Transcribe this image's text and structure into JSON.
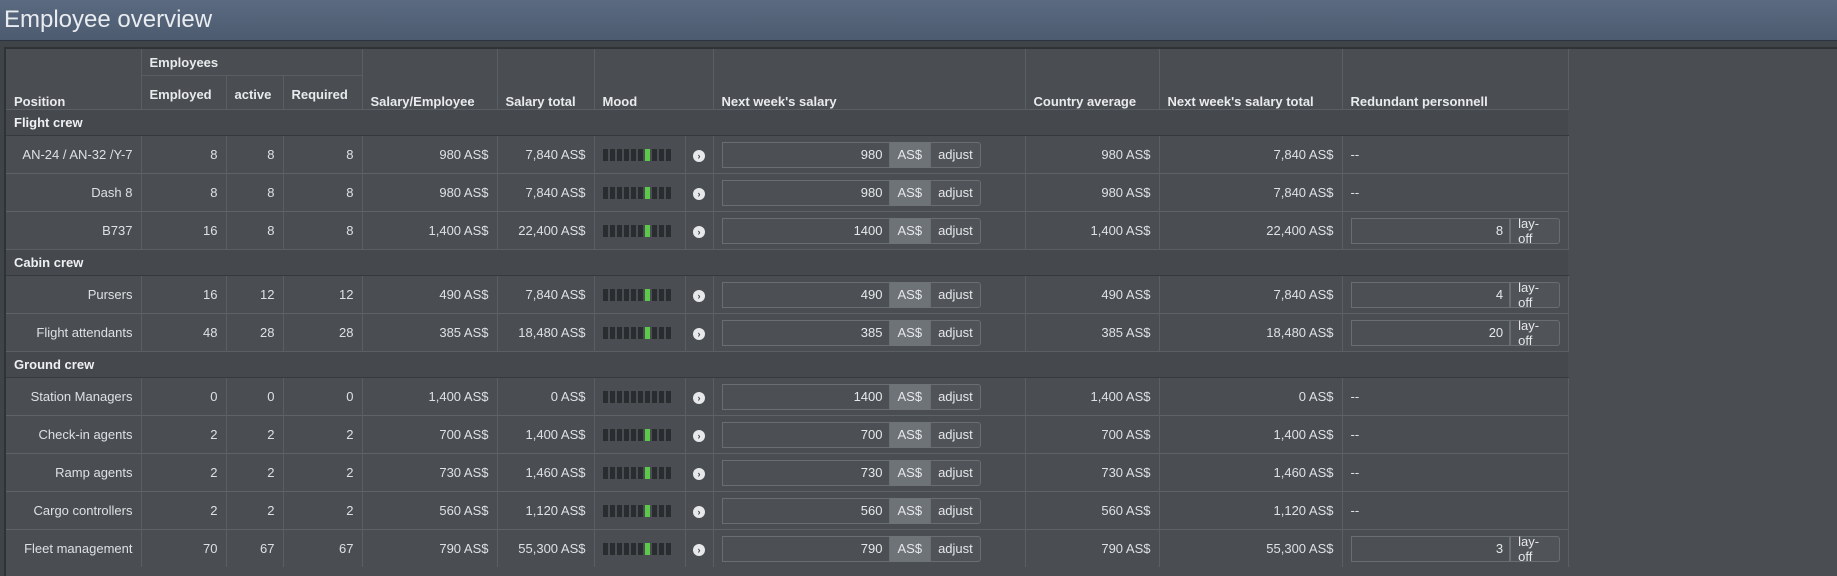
{
  "window": {
    "title": "Employee overview"
  },
  "headers": {
    "position": "Position",
    "employees_group": "Employees",
    "employed": "Employed",
    "active": "active",
    "required": "Required",
    "salary_employee": "Salary/Employee",
    "salary_total": "Salary total",
    "mood": "Mood",
    "next_week_salary": "Next week's salary",
    "country_average": "Country average",
    "next_week_total": "Next week's salary total",
    "redundant": "Redundant personnell"
  },
  "labels": {
    "currency": "AS$",
    "adjust": "adjust",
    "layoff": "lay-off",
    "none": "--"
  },
  "colors": {
    "mood_on": "#5cc94a",
    "mood_off": "#2a2d30",
    "title_bar": "#56667c"
  },
  "sections": [
    {
      "name": "Flight crew",
      "rows": [
        {
          "position": "AN-24 / AN-32 /Y-7",
          "employed": "8",
          "active": "8",
          "required": "8",
          "salary": "980 AS$",
          "total": "7,840 AS$",
          "mood_level": 6,
          "next_salary": "980",
          "country_avg": "980 AS$",
          "next_total": "7,840 AS$",
          "redundant": "--",
          "layoff": false
        },
        {
          "position": "Dash 8",
          "employed": "8",
          "active": "8",
          "required": "8",
          "salary": "980 AS$",
          "total": "7,840 AS$",
          "mood_level": 6,
          "next_salary": "980",
          "country_avg": "980 AS$",
          "next_total": "7,840 AS$",
          "redundant": "--",
          "layoff": false
        },
        {
          "position": "B737",
          "employed": "16",
          "active": "8",
          "required": "8",
          "salary": "1,400 AS$",
          "total": "22,400 AS$",
          "mood_level": 6,
          "next_salary": "1400",
          "country_avg": "1,400 AS$",
          "next_total": "22,400 AS$",
          "redundant": "8",
          "layoff": true
        }
      ]
    },
    {
      "name": "Cabin crew",
      "rows": [
        {
          "position": "Pursers",
          "employed": "16",
          "active": "12",
          "required": "12",
          "salary": "490 AS$",
          "total": "7,840 AS$",
          "mood_level": 6,
          "next_salary": "490",
          "country_avg": "490 AS$",
          "next_total": "7,840 AS$",
          "redundant": "4",
          "layoff": true
        },
        {
          "position": "Flight attendants",
          "employed": "48",
          "active": "28",
          "required": "28",
          "salary": "385 AS$",
          "total": "18,480 AS$",
          "mood_level": 6,
          "next_salary": "385",
          "country_avg": "385 AS$",
          "next_total": "18,480 AS$",
          "redundant": "20",
          "layoff": true
        }
      ]
    },
    {
      "name": "Ground crew",
      "rows": [
        {
          "position": "Station Managers",
          "employed": "0",
          "active": "0",
          "required": "0",
          "salary": "1,400 AS$",
          "total": "0 AS$",
          "mood_level": 0,
          "next_salary": "1400",
          "country_avg": "1,400 AS$",
          "next_total": "0 AS$",
          "redundant": "--",
          "layoff": false
        },
        {
          "position": "Check-in agents",
          "employed": "2",
          "active": "2",
          "required": "2",
          "salary": "700 AS$",
          "total": "1,400 AS$",
          "mood_level": 6,
          "next_salary": "700",
          "country_avg": "700 AS$",
          "next_total": "1,400 AS$",
          "redundant": "--",
          "layoff": false
        },
        {
          "position": "Ramp agents",
          "employed": "2",
          "active": "2",
          "required": "2",
          "salary": "730 AS$",
          "total": "1,460 AS$",
          "mood_level": 6,
          "next_salary": "730",
          "country_avg": "730 AS$",
          "next_total": "1,460 AS$",
          "redundant": "--",
          "layoff": false
        },
        {
          "position": "Cargo controllers",
          "employed": "2",
          "active": "2",
          "required": "2",
          "salary": "560 AS$",
          "total": "1,120 AS$",
          "mood_level": 6,
          "next_salary": "560",
          "country_avg": "560 AS$",
          "next_total": "1,120 AS$",
          "redundant": "--",
          "layoff": false
        },
        {
          "position": "Fleet management",
          "employed": "70",
          "active": "67",
          "required": "67",
          "salary": "790 AS$",
          "total": "55,300 AS$",
          "mood_level": 6,
          "next_salary": "790",
          "country_avg": "790 AS$",
          "next_total": "55,300 AS$",
          "redundant": "3",
          "layoff": true
        }
      ]
    }
  ]
}
